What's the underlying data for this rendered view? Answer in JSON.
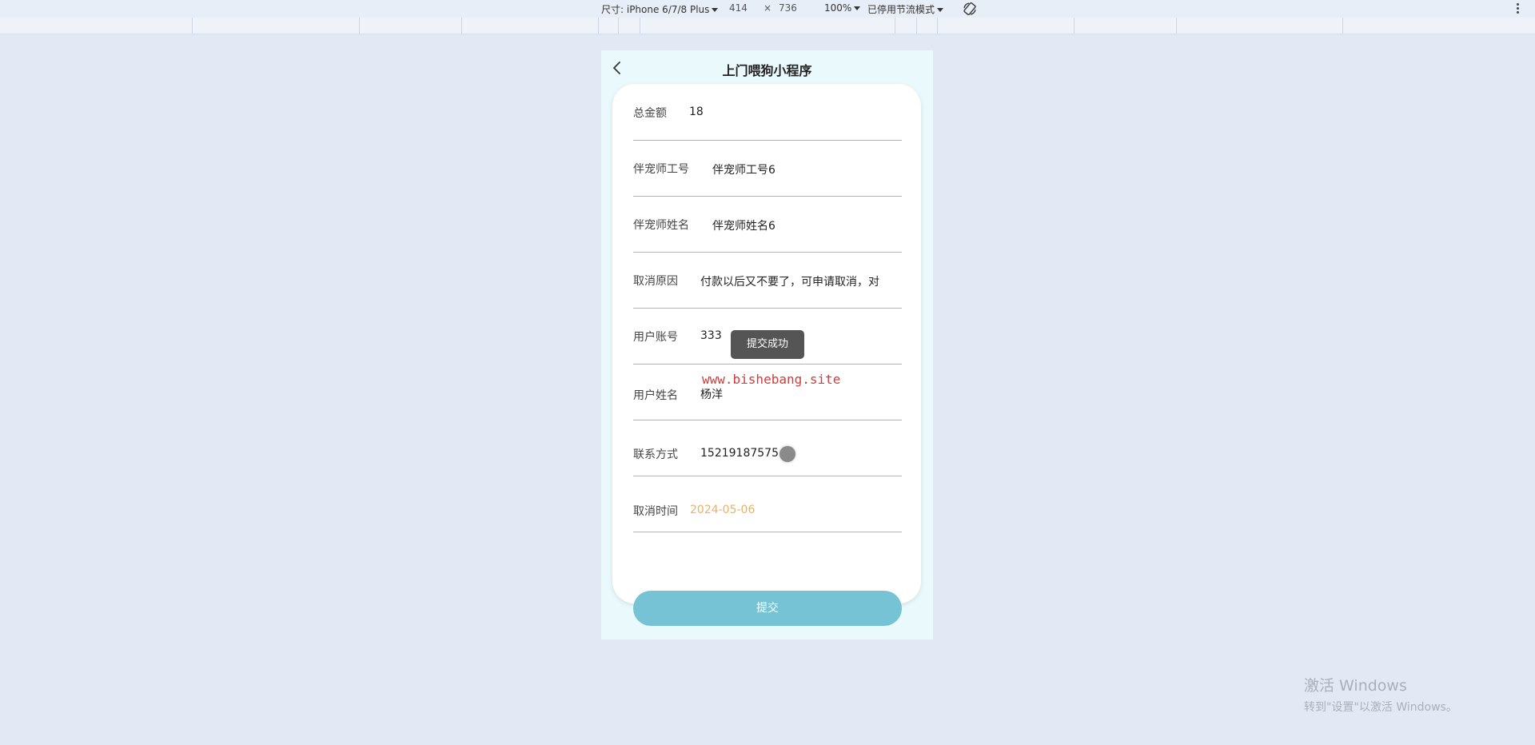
{
  "devtools": {
    "device_label": "尺寸: iPhone 6/7/8 Plus",
    "width": "414",
    "times": "×",
    "height": "736",
    "zoom": "100%",
    "throttle": "已停用节流模式",
    "rotate_icon": "rotate-icon",
    "menu_icon": "more-vertical-icon"
  },
  "app": {
    "title": "上门喂狗小程序",
    "back_icon": "chevron-left-icon"
  },
  "form": {
    "fields": [
      {
        "label": "总金额",
        "value": "18"
      },
      {
        "label": "伴宠师工号",
        "value": "伴宠师工号6"
      },
      {
        "label": "伴宠师姓名",
        "value": "伴宠师姓名6"
      },
      {
        "label": "取消原因",
        "value": "付款以后又不要了，可申请取消，对"
      },
      {
        "label": "用户账号",
        "value": "333"
      },
      {
        "label": "用户姓名",
        "value": "杨洋"
      },
      {
        "label": "联系方式",
        "value": "15219187575"
      },
      {
        "label": "取消时间",
        "value": "2024-05-06"
      }
    ],
    "submit_label": "提交"
  },
  "toast": "提交成功",
  "watermark": "www.bishebang.site",
  "windows_activation": {
    "title": "激活 Windows",
    "subtitle": "转到\"设置\"以激活 Windows。"
  },
  "colors": {
    "page_bg": "#e2e9f4",
    "submit_button": "#76c3d5",
    "date_text": "#e8b267",
    "watermark": "#d23b3b"
  }
}
